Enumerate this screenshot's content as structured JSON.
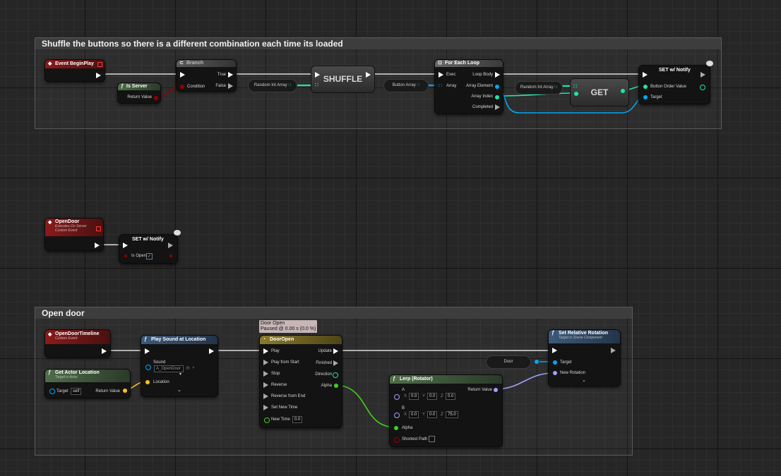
{
  "comments": [
    {
      "title": "Shuffle the buttons so there is a different combination each time its loaded"
    },
    {
      "title": "Open door"
    }
  ],
  "event_begin_play": {
    "title": "Event BeginPlay"
  },
  "is_server": {
    "title": "Is Server",
    "return_value": "Return Value"
  },
  "branch": {
    "title": "Branch",
    "condition": "Condition",
    "true": "True",
    "false": "False"
  },
  "random_int_array_1": {
    "label": "Random Int Array"
  },
  "shuffle": {
    "label": "SHUFFLE"
  },
  "button_array": {
    "label": "Button Array"
  },
  "for_each_loop": {
    "title": "For Each Loop",
    "exec": "Exec",
    "array": "Array",
    "loop_body": "Loop Body",
    "array_element": "Array Element",
    "array_index": "Array Index",
    "completed": "Completed"
  },
  "random_int_array_2": {
    "label": "Random Int Array"
  },
  "get": {
    "label": "GET"
  },
  "set_notify_1": {
    "title": "SET w/ Notify",
    "button_order_value": "Button Order Value",
    "target": "Target"
  },
  "open_door_event": {
    "title": "OpenDoor",
    "sub1": "Executes On Server",
    "sub2": "Custom Event"
  },
  "set_notify_2": {
    "title": "SET w/ Notify",
    "is_open": "Is Open"
  },
  "open_door_timeline_event": {
    "title": "OpenDoorTimeline",
    "sub": "Custom Event"
  },
  "get_actor_location": {
    "title": "Get Actor Location",
    "sub": "Target is Actor",
    "target": "Target",
    "target_value": "self",
    "return_value": "Return Value"
  },
  "play_sound": {
    "title": "Play Sound at Location",
    "sound": "Sound",
    "sound_value": "A_OpenDoor",
    "location": "Location"
  },
  "timeline_tooltip": {
    "line1": "Door Open",
    "line2": "Paused @ 0.00 s (0.0 %)"
  },
  "door_open_timeline": {
    "title": "DoorOpen",
    "play": "Play",
    "play_from_start": "Play from Start",
    "stop": "Stop",
    "reverse": "Reverse",
    "reverse_from_end": "Reverse from End",
    "set_new_time": "Set New Time",
    "new_time": "New Time",
    "new_time_value": "0.0",
    "update": "Update",
    "finished": "Finished",
    "direction": "Direction",
    "alpha": "Alpha"
  },
  "lerp_rotator": {
    "title": "Lerp (Rotator)",
    "a": "A",
    "b": "B",
    "ax": "0.0",
    "ay": "0.0",
    "az": "0.0",
    "bx": "0.0",
    "by": "0.0",
    "bz": "75.0",
    "x": "X",
    "y": "Y",
    "z": "Z",
    "alpha": "Alpha",
    "shortest_path": "Shortest Path",
    "return_value": "Return Value"
  },
  "door_var": {
    "label": "Door"
  },
  "set_relative_rotation": {
    "title": "Set Relative Rotation",
    "sub": "Target is Scene Component",
    "target": "Target",
    "new_rotation": "New Rotation"
  },
  "colors": {
    "event_header": "#8b1a1a",
    "function_header": "#3d5a7a",
    "pure_header": "#4f6e4a",
    "timeline_header": "#8a7a2a",
    "exec_wire": "#ffffff",
    "int_wire": "#1fe3af",
    "object_wire": "#00a8f4",
    "bool_wire": "#930000",
    "float_wire": "#40d020",
    "struct_wire": "#ffc020",
    "rotator_wire": "#9ea0ff"
  }
}
